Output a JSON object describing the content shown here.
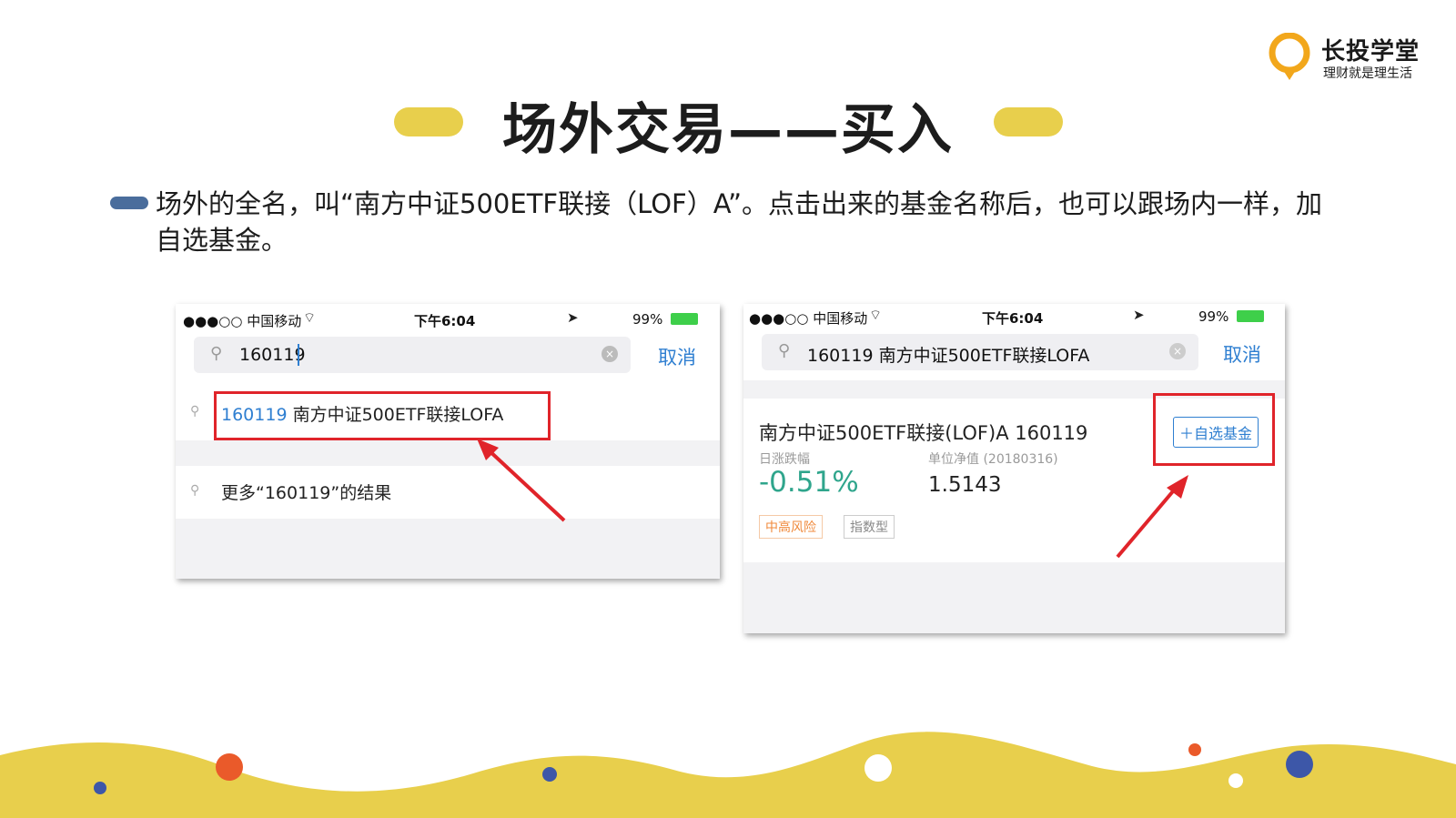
{
  "logo": {
    "name": "长投学堂",
    "slogan": "理财就是理生活"
  },
  "title": "场外交易——买入",
  "description": "场外的全名，叫“南方中证500ETF联接（LOF）A”。点击出来的基金名称后，也可以跟场内一样，加自选基金。",
  "colors": {
    "accent_yellow": "#e8cf4c",
    "bullet_blue": "#4a6d9c",
    "link_blue": "#2f7fd1",
    "highlight_red": "#e0242a",
    "drop_green": "#2fa58c",
    "tag_orange": "#f08a3c"
  },
  "left_phone": {
    "status": {
      "carrier": "●●●○○ 中国移动",
      "time": "下午6:04",
      "battery": "99%"
    },
    "search": {
      "value": "160119",
      "cancel": "取消"
    },
    "suggestion": {
      "code": "160119",
      "name": "南方中证500ETF联接LOFA"
    },
    "more": "更多“160119”的结果"
  },
  "right_phone": {
    "status": {
      "carrier": "●●●○○ 中国移动",
      "time": "下午6:04",
      "battery": "99%"
    },
    "search": {
      "value": "160119 南方中证500ETF联接LOFA",
      "cancel": "取消"
    },
    "fund": {
      "name": "南方中证500ETF联接(LOF)A 160119",
      "change_label": "日涨跌幅",
      "change_value": "-0.51%",
      "nav_label": "单位净值 (20180316)",
      "nav_value": "1.5143",
      "tags": [
        "中高风险",
        "指数型"
      ],
      "add_button": "＋自选基金"
    }
  }
}
